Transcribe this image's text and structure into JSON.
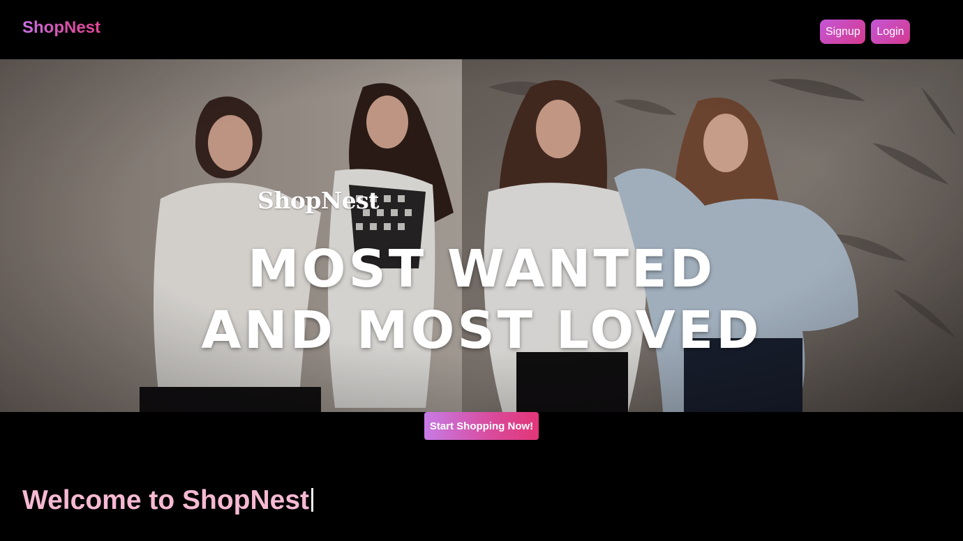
{
  "navbar": {
    "brand": "ShopNest",
    "signup_label": "Signup",
    "login_label": "Login"
  },
  "hero": {
    "logo_text": "ShopNest",
    "headline_line1": "MOST WANTED",
    "headline_line2": "AND MOST LOVED",
    "image_description_icon": "hero-photo"
  },
  "cta": {
    "label": "Start Shopping Now!"
  },
  "welcome": {
    "text": "Welcome to ShopNest"
  },
  "colors": {
    "background": "#000000",
    "accent_pink": "#d94a9b",
    "accent_purple": "#c77be6",
    "welcome_text": "#f6b9d2"
  }
}
